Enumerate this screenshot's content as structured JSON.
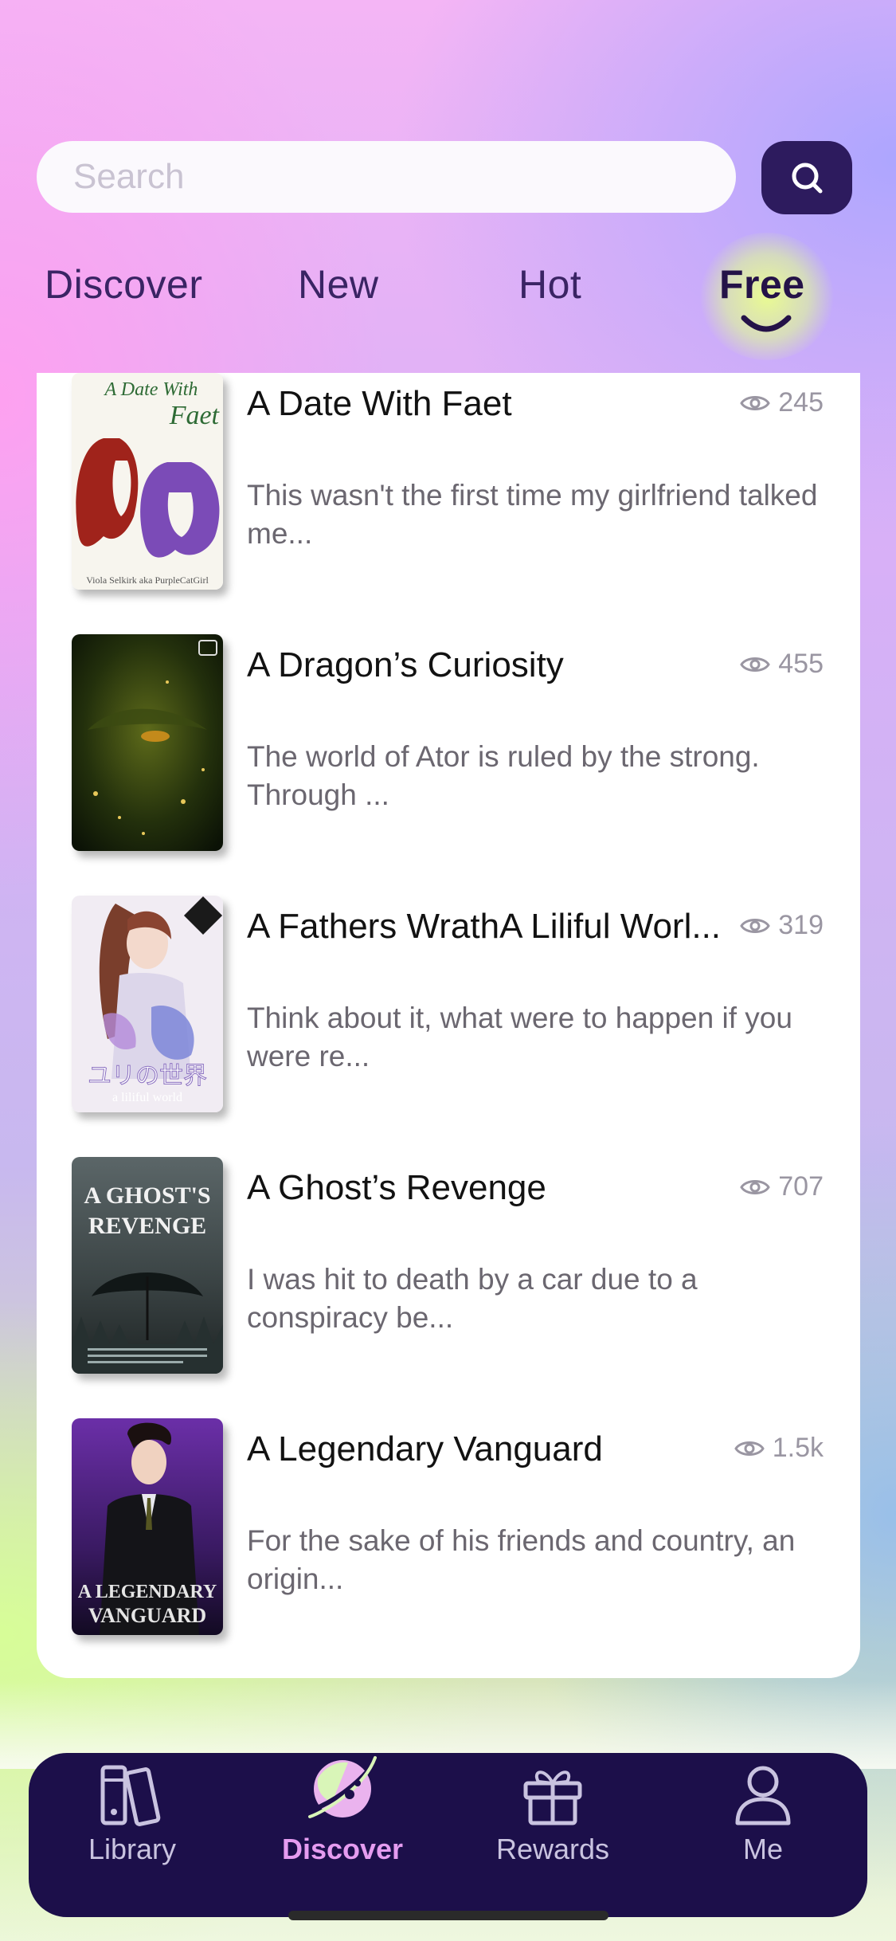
{
  "search": {
    "placeholder": "Search"
  },
  "tabs": [
    {
      "label": "Discover",
      "active": false
    },
    {
      "label": "New",
      "active": false
    },
    {
      "label": "Hot",
      "active": false
    },
    {
      "label": "Free",
      "active": true
    }
  ],
  "books": [
    {
      "title": "A Date With Faet",
      "views": "245",
      "description": "This wasn't the first time my girlfriend talked me...",
      "cover_text": "A Date With Faet",
      "cover_author": "Viola Selkirk aka PurpleCatGirl"
    },
    {
      "title": "A Dragon’s Curiosity",
      "views": "455",
      "description": "The world of Ator is ruled by the strong. Through ..."
    },
    {
      "title": "A Fathers WrathA Liliful Worl...",
      "views": "319",
      "description": "Think about it, what were to happen if you were re...",
      "cover_text": "a liliful world"
    },
    {
      "title": "A Ghost’s Revenge",
      "views": "707",
      "description": "I was hit to death by a car due to a conspiracy be...",
      "cover_text": "A GHOST'S REVENGE"
    },
    {
      "title": "A Legendary Vanguard",
      "views": "1.5k",
      "description": "For the sake of his friends and country, an origin...",
      "cover_text": "A LEGENDARY VANGUARD"
    }
  ],
  "nav": [
    {
      "label": "Library",
      "icon": "books-icon",
      "active": false
    },
    {
      "label": "Discover",
      "icon": "planet-icon",
      "active": true
    },
    {
      "label": "Rewards",
      "icon": "gift-icon",
      "active": false
    },
    {
      "label": "Me",
      "icon": "person-icon",
      "active": false
    }
  ],
  "colors": {
    "accent": "#2d1b5e",
    "nav_bg": "#1c0f4a",
    "nav_active": "#e59cf0"
  }
}
